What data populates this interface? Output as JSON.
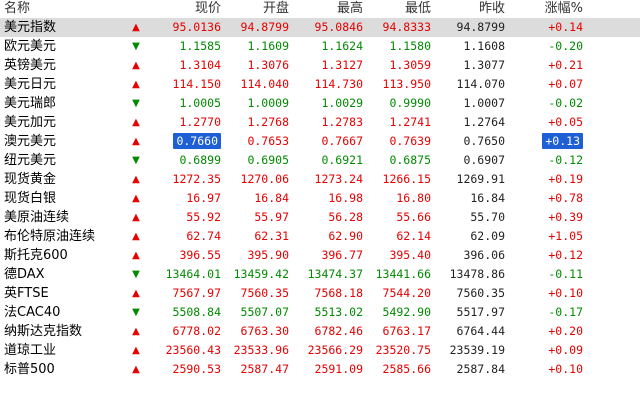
{
  "header": {
    "name": "名称",
    "current": "现价",
    "open": "开盘",
    "high": "最高",
    "low": "最低",
    "prev_close": "昨收",
    "change_pct": "涨幅%"
  },
  "colors": {
    "up": "#e60000",
    "down": "#008a00",
    "highlight": "#1f5fd6",
    "selected_row": "#dcdcdc"
  },
  "rows": [
    {
      "name": "美元指数",
      "dir": "up",
      "current": "95.0136",
      "open": "94.8799",
      "high": "95.0846",
      "low": "94.8333",
      "prev": "94.8799",
      "pct": "+0.14"
    },
    {
      "name": "欧元美元",
      "dir": "down",
      "current": "1.1585",
      "open": "1.1609",
      "high": "1.1624",
      "low": "1.1580",
      "prev": "1.1608",
      "pct": "-0.20"
    },
    {
      "name": "英镑美元",
      "dir": "up",
      "current": "1.3104",
      "open": "1.3076",
      "high": "1.3127",
      "low": "1.3059",
      "prev": "1.3077",
      "pct": "+0.21"
    },
    {
      "name": "美元日元",
      "dir": "up",
      "current": "114.150",
      "open": "114.040",
      "high": "114.730",
      "low": "113.950",
      "prev": "114.070",
      "pct": "+0.07"
    },
    {
      "name": "美元瑞郎",
      "dir": "down",
      "current": "1.0005",
      "open": "1.0009",
      "high": "1.0029",
      "low": "0.9990",
      "prev": "1.0007",
      "pct": "-0.02"
    },
    {
      "name": "美元加元",
      "dir": "up",
      "current": "1.2770",
      "open": "1.2768",
      "high": "1.2783",
      "low": "1.2741",
      "prev": "1.2764",
      "pct": "+0.05"
    },
    {
      "name": "澳元美元",
      "dir": "up",
      "current": "0.7660",
      "open": "0.7653",
      "high": "0.7667",
      "low": "0.7639",
      "prev": "0.7650",
      "pct": "+0.13"
    },
    {
      "name": "纽元美元",
      "dir": "down",
      "current": "0.6899",
      "open": "0.6905",
      "high": "0.6921",
      "low": "0.6875",
      "prev": "0.6907",
      "pct": "-0.12"
    },
    {
      "name": "现货黄金",
      "dir": "up",
      "current": "1272.35",
      "open": "1270.06",
      "high": "1273.24",
      "low": "1266.15",
      "prev": "1269.91",
      "pct": "+0.19"
    },
    {
      "name": "现货白银",
      "dir": "up",
      "current": "16.97",
      "open": "16.84",
      "high": "16.98",
      "low": "16.80",
      "prev": "16.84",
      "pct": "+0.78"
    },
    {
      "name": "美原油连续",
      "dir": "up",
      "current": "55.92",
      "open": "55.97",
      "high": "56.28",
      "low": "55.66",
      "prev": "55.70",
      "pct": "+0.39"
    },
    {
      "name": "布伦特原油连续",
      "dir": "up",
      "current": "62.74",
      "open": "62.31",
      "high": "62.90",
      "low": "62.14",
      "prev": "62.09",
      "pct": "+1.05"
    },
    {
      "name": "斯托克600",
      "dir": "up",
      "current": "396.55",
      "open": "395.90",
      "high": "396.77",
      "low": "395.40",
      "prev": "396.06",
      "pct": "+0.12"
    },
    {
      "name": "德DAX",
      "dir": "down",
      "current": "13464.01",
      "open": "13459.42",
      "high": "13474.37",
      "low": "13441.66",
      "prev": "13478.86",
      "pct": "-0.11"
    },
    {
      "name": "英FTSE",
      "dir": "up",
      "current": "7567.97",
      "open": "7560.35",
      "high": "7568.18",
      "low": "7544.20",
      "prev": "7560.35",
      "pct": "+0.10"
    },
    {
      "name": "法CAC40",
      "dir": "down",
      "current": "5508.84",
      "open": "5507.07",
      "high": "5513.02",
      "low": "5492.90",
      "prev": "5517.97",
      "pct": "-0.17"
    },
    {
      "name": "纳斯达克指数",
      "dir": "up",
      "current": "6778.02",
      "open": "6763.30",
      "high": "6782.46",
      "low": "6763.17",
      "prev": "6764.44",
      "pct": "+0.20"
    },
    {
      "name": "道琼工业",
      "dir": "up",
      "current": "23560.43",
      "open": "23533.96",
      "high": "23566.29",
      "low": "23520.75",
      "prev": "23539.19",
      "pct": "+0.09"
    },
    {
      "name": "标普500",
      "dir": "up",
      "current": "2590.53",
      "open": "2587.47",
      "high": "2591.09",
      "low": "2585.66",
      "prev": "2587.84",
      "pct": "+0.10"
    }
  ]
}
